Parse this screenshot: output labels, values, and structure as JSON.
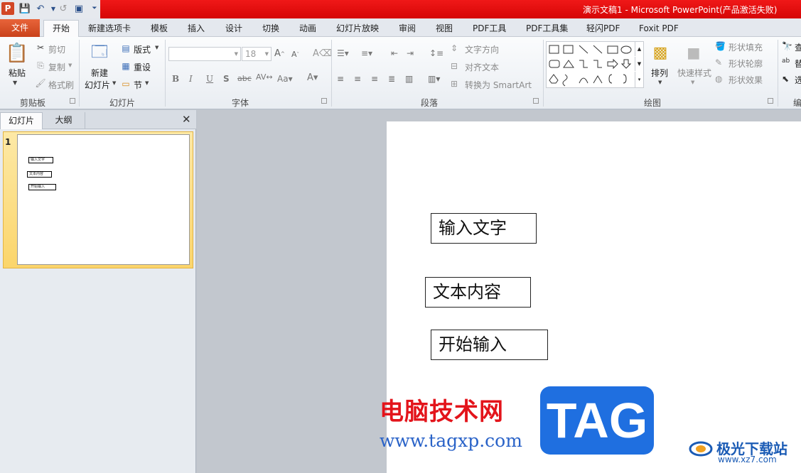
{
  "titlebar": {
    "title": "演示文稿1 - Microsoft PowerPoint(产品激活失败)"
  },
  "tabs": [
    "文件",
    "开始",
    "新建选项卡",
    "模板",
    "插入",
    "设计",
    "切换",
    "动画",
    "幻灯片放映",
    "审阅",
    "视图",
    "PDF工具",
    "PDF工具集",
    "轻闪PDF",
    "Foxit PDF"
  ],
  "clipboard": {
    "paste": "粘贴",
    "cut": "剪切",
    "copy": "复制",
    "format_painter": "格式刷",
    "label": "剪贴板"
  },
  "slides_group": {
    "new_slide_line1": "新建",
    "new_slide_line2": "幻灯片",
    "layout": "版式",
    "reset": "重设",
    "section": "节",
    "label": "幻灯片"
  },
  "font_group": {
    "font_size": "18",
    "label": "字体"
  },
  "paragraph_group": {
    "text_direction": "文字方向",
    "align_text": "对齐文本",
    "convert_smartart": "转换为 SmartArt",
    "label": "段落"
  },
  "drawing_group": {
    "arrange": "排列",
    "quick_styles": "快速样式",
    "shape_fill": "形状填充",
    "shape_outline": "形状轮廓",
    "shape_effects": "形状效果",
    "label": "绘图"
  },
  "editing_group": {
    "find": "查",
    "replace": "替",
    "select": "选",
    "label": "编"
  },
  "panel": {
    "tab_slides": "幻灯片",
    "tab_outline": "大纲",
    "slide_number": "1"
  },
  "slide": {
    "box1": "输入文字",
    "box2": "文本内容",
    "box3": "开始输入"
  },
  "watermark": {
    "cn": "电脑技术网",
    "url": "www.tagxp.com",
    "tag": "TAG",
    "jg": "极光下载站",
    "jg_url": "www.xz7.com"
  }
}
